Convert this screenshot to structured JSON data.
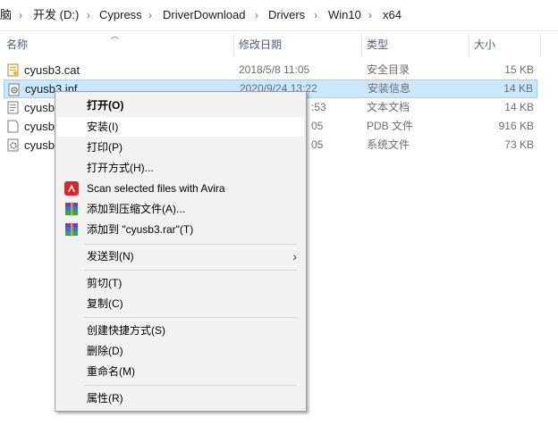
{
  "breadcrumb": {
    "items": [
      "脑",
      "开发 (D:)",
      "Cypress",
      "DriverDownload",
      "Drivers",
      "Win10",
      "x64"
    ],
    "separator": "›"
  },
  "columns": {
    "name": "名称",
    "date": "修改日期",
    "type": "类型",
    "size": "大小"
  },
  "files": [
    {
      "name": "cyusb3.cat",
      "date": "2018/5/8 11:05",
      "type": "安全目录",
      "size": "15 KB",
      "icon": "certificate-file-icon"
    },
    {
      "name": "cyusb3.inf",
      "date": "2020/9/24 13:22",
      "type": "安装信息",
      "size": "14 KB",
      "icon": "setup-information-file-icon"
    },
    {
      "name": "cyusb",
      "date": ":53",
      "type": "文本文档",
      "size": "14 KB",
      "icon": "text-document-icon"
    },
    {
      "name": "cyusb",
      "date": "05",
      "type": "PDB 文件",
      "size": "916 KB",
      "icon": "blank-file-icon"
    },
    {
      "name": "cyusb",
      "date": "05",
      "type": "系统文件",
      "size": "73 KB",
      "icon": "system-file-icon"
    }
  ],
  "context_menu": {
    "open": "打开(O)",
    "install": "安装(I)",
    "print": "打印(P)",
    "open_with": "打开方式(H)...",
    "scan_avira": "Scan selected files with Avira",
    "add_archive": "添加到压缩文件(A)...",
    "add_rar": "添加到 \"cyusb3.rar\"(T)",
    "send_to": "发送到(N)",
    "cut": "剪切(T)",
    "copy": "复制(C)",
    "create_shortcut": "创建快捷方式(S)",
    "delete": "删除(D)",
    "rename": "重命名(M)",
    "properties": "属性(R)"
  },
  "colors": {
    "selection_bg": "#cce8ff",
    "selection_border": "#99d1ff",
    "avira_red": "#d9262c",
    "menu_bg": "#f2f2f2"
  }
}
